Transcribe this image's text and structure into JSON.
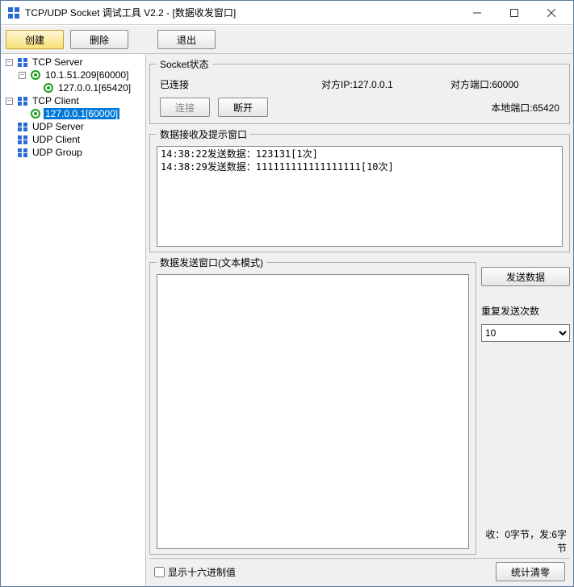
{
  "window": {
    "title": "TCP/UDP Socket 调试工具 V2.2 - [数据收发窗口]"
  },
  "toolbar": {
    "create": "创建",
    "delete": "删除",
    "exit": "退出"
  },
  "tree": {
    "tcp_server": "TCP Server",
    "server1": "10.1.51.209[60000]",
    "server1_client": "127.0.0.1[65420]",
    "tcp_client": "TCP Client",
    "client1": "127.0.0.1[60000]",
    "udp_server": "UDP Server",
    "udp_client": "UDP Client",
    "udp_group": "UDP Group"
  },
  "status": {
    "group_title": "Socket状态",
    "state": "已连接",
    "peer_ip_label": "对方IP:127.0.0.1",
    "peer_port_label": "对方端口:60000",
    "connect_btn": "连接",
    "disconnect_btn": "断开",
    "local_port_label": "本地端口:65420"
  },
  "recv": {
    "group_title": "数据接收及提示窗口",
    "log": "14:38:22发送数据：123131[1次]\n14:38:29发送数据：111111111111111111[10次]"
  },
  "send": {
    "group_title": "数据发送窗口(文本模式)",
    "btn": "发送数据",
    "repeat_label": "重复发送次数",
    "repeat_value": "10",
    "textarea_value": ""
  },
  "counters": {
    "text": "收：0字节，发:6字节"
  },
  "bottom": {
    "hex_label": "显示十六进制值",
    "reset_btn": "统计清零"
  }
}
